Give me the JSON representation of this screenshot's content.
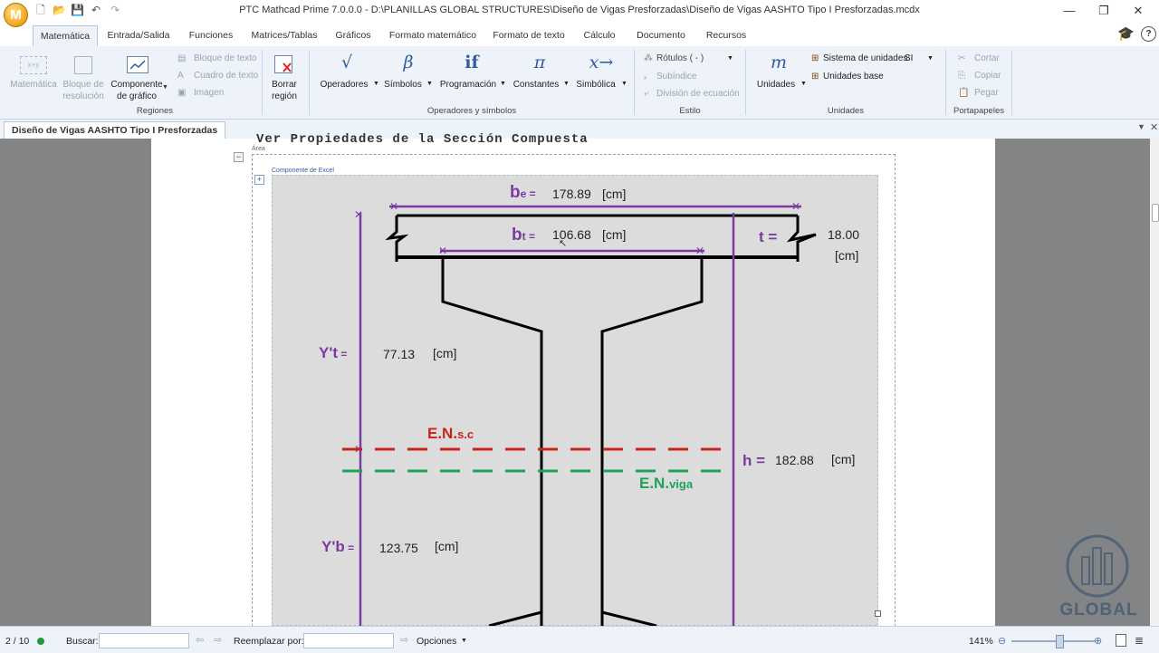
{
  "window": {
    "title": "PTC Mathcad Prime 7.0.0.0 - D:\\PLANILLAS GLOBAL STRUCTURES\\Diseño de Vigas Presforzadas\\Diseño de Vigas AASHTO Tipo I Presforzadas.mcdx",
    "logo_letter": "M"
  },
  "tabs": [
    {
      "label": "Matemática",
      "active": true
    },
    {
      "label": "Entrada/Salida"
    },
    {
      "label": "Funciones"
    },
    {
      "label": "Matrices/Tablas"
    },
    {
      "label": "Gráficos"
    },
    {
      "label": "Formato matemático"
    },
    {
      "label": "Formato de texto"
    },
    {
      "label": "Cálculo"
    },
    {
      "label": "Documento"
    },
    {
      "label": "Recursos"
    }
  ],
  "ribbon": {
    "regiones": {
      "label": "Regiones",
      "matematica": "Matemática",
      "bloque_resolucion": "Bloque de resolución",
      "componente_grafico": "Componente de gráfico",
      "bloque_texto": "Bloque de texto",
      "cuadro_texto": "Cuadro de texto",
      "imagen": "Imagen",
      "borrar_region": "Borrar región"
    },
    "operadores": {
      "label": "Operadores y símbolos",
      "operadores": "Operadores",
      "simbolos": "Símbolos",
      "programacion": "Programación",
      "constantes": "Constantes",
      "simbolica": "Simbólica",
      "glyphs": {
        "operadores": "√",
        "simbolos": "β",
        "programacion": "if",
        "constantes": "π",
        "simbolica": "x→"
      }
    },
    "estilo": {
      "label": "Estilo",
      "rotulos": "Rótulos  ( - )",
      "subindice": "Subíndice",
      "division": "División de ecuación"
    },
    "unidades": {
      "label": "Unidades",
      "unidades": "Unidades",
      "glyph": "m",
      "sistema": "Sistema de unidades:",
      "sistema_value": "SI",
      "base": "Unidades base"
    },
    "portapapeles": {
      "label": "Portapapeles",
      "cortar": "Cortar",
      "copiar": "Copiar",
      "pegar": "Pegar"
    }
  },
  "document": {
    "tab_title": "Diseño de Vigas AASHTO Tipo I Presforzadas",
    "heading": "Ver Propiedades de la Sección Compuesta",
    "area_label": "Área",
    "component_label": "Componente de Excel"
  },
  "drawing": {
    "be_label": "b",
    "be_sub": "e =",
    "be_value": "178.89",
    "be_unit": "[cm]",
    "bt_label": "b",
    "bt_sub": "t =",
    "bt_value": "106.68",
    "bt_unit": "[cm]",
    "t_label": "t =",
    "t_value": "18.00",
    "t_unit": "[cm]",
    "yt_label": "Y't",
    "yt_sub": " =",
    "yt_value": "77.13",
    "yt_unit": "[cm]",
    "yb_label": "Y'b",
    "yb_sub": " =",
    "yb_value": "123.75",
    "yb_unit": "[cm]",
    "h_label": "h =",
    "h_value": "182.88",
    "h_unit": "[cm]",
    "ensc_label": "E.N.",
    "ensc_sub": "s.c",
    "enviga_label": "E.N.",
    "enviga_sub": "viga",
    "colors": {
      "purple": "#7a3aa0",
      "red": "#c8231c",
      "green": "#1fa35a",
      "section": "#000000",
      "bg": "#dcdcdc"
    }
  },
  "status": {
    "page": "2 / 10",
    "buscar": "Buscar:",
    "reemplazar": "Reemplazar por:",
    "opciones": "Opciones",
    "zoom": "141%"
  },
  "watermark": {
    "text": "GLOBAL"
  }
}
